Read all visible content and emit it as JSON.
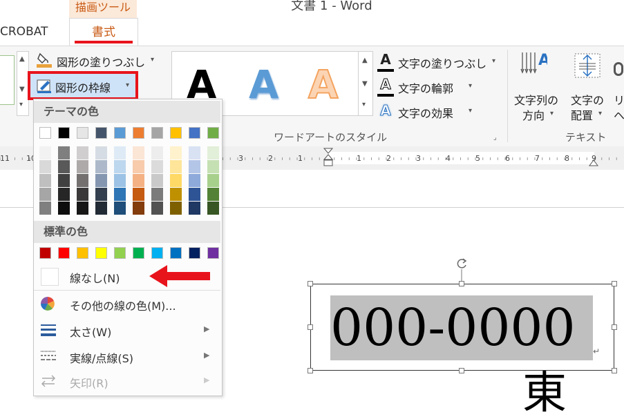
{
  "titlebar": {
    "context_group_label": "描画ツール",
    "document_title": "文書 1 - Word"
  },
  "tabs": {
    "acrobat_label": "CROBAT",
    "format_label": "書式"
  },
  "ribbon": {
    "shape_fill_label": "図形の塗りつぶし",
    "shape_outline_label": "図形の枠線",
    "wordart_sample_letter": "A",
    "text_fill_label": "文字の塗りつぶし",
    "text_outline_label": "文字の輪郭",
    "text_effect_label": "文字の効果",
    "wordart_group_label": "ワードアートのスタイル",
    "text_direction_label_1": "文字列の",
    "text_direction_label_2": "方向",
    "text_align_label_1": "文字の",
    "text_align_label_2": "配置",
    "text_group_label": "テキスト",
    "cut_label_1": "リ",
    "cut_label_2": "ヘ"
  },
  "ruler": {
    "labels_left": [
      "11",
      "10",
      "3",
      "2",
      "1"
    ],
    "labels_right": [
      "1",
      "2",
      "3",
      "4",
      "5",
      "6",
      "7",
      "8",
      "9"
    ]
  },
  "dropdown": {
    "theme_colors_header": "テーマの色",
    "standard_colors_header": "標準の色",
    "no_line_label": "線なし(N)",
    "more_colors_label": "その他の線の色(M)...",
    "weight_label": "太さ(W)",
    "dashes_label": "実線/点線(S)",
    "arrows_label": "矢印(R)",
    "theme_top_row": [
      "#ffffff",
      "#000000",
      "#e7e6e6",
      "#44546a",
      "#5b9bd5",
      "#ed7d31",
      "#a5a5a5",
      "#ffc000",
      "#4472c4",
      "#70ad47"
    ],
    "theme_shades": [
      [
        "#f2f2f2",
        "#d9d9d9",
        "#bfbfbf",
        "#a6a6a6",
        "#7f7f7f"
      ],
      [
        "#7f7f7f",
        "#595959",
        "#404040",
        "#262626",
        "#0d0d0d"
      ],
      [
        "#d0cece",
        "#aeaaaa",
        "#757070",
        "#3a3838",
        "#171616"
      ],
      [
        "#d6dce4",
        "#adb9ca",
        "#8496b0",
        "#333f4f",
        "#222a35"
      ],
      [
        "#deebf6",
        "#bdd7ee",
        "#9cc3e5",
        "#2e75b5",
        "#1e4e79"
      ],
      [
        "#fbe5d5",
        "#f7cbac",
        "#f4b183",
        "#c55a11",
        "#833c0b"
      ],
      [
        "#ededed",
        "#dbdbdb",
        "#c9c9c9",
        "#7b7b7b",
        "#525252"
      ],
      [
        "#fff2cc",
        "#fee599",
        "#ffd965",
        "#bf9000",
        "#7f6000"
      ],
      [
        "#d9e2f3",
        "#b4c6e7",
        "#8eaadb",
        "#2f5496",
        "#1f3864"
      ],
      [
        "#e2efd9",
        "#c5e0b3",
        "#a8d08d",
        "#538135",
        "#375623"
      ]
    ],
    "standard_colors": [
      "#c00000",
      "#ff0000",
      "#ffc000",
      "#ffff00",
      "#92d050",
      "#00b050",
      "#00b0f0",
      "#0070c0",
      "#002060",
      "#7030a0"
    ]
  },
  "document": {
    "textbox_text": "000-0000",
    "partial_char_below": "東"
  },
  "colors": {
    "accent_red": "#e8141c",
    "context_orange": "#c95a14"
  }
}
